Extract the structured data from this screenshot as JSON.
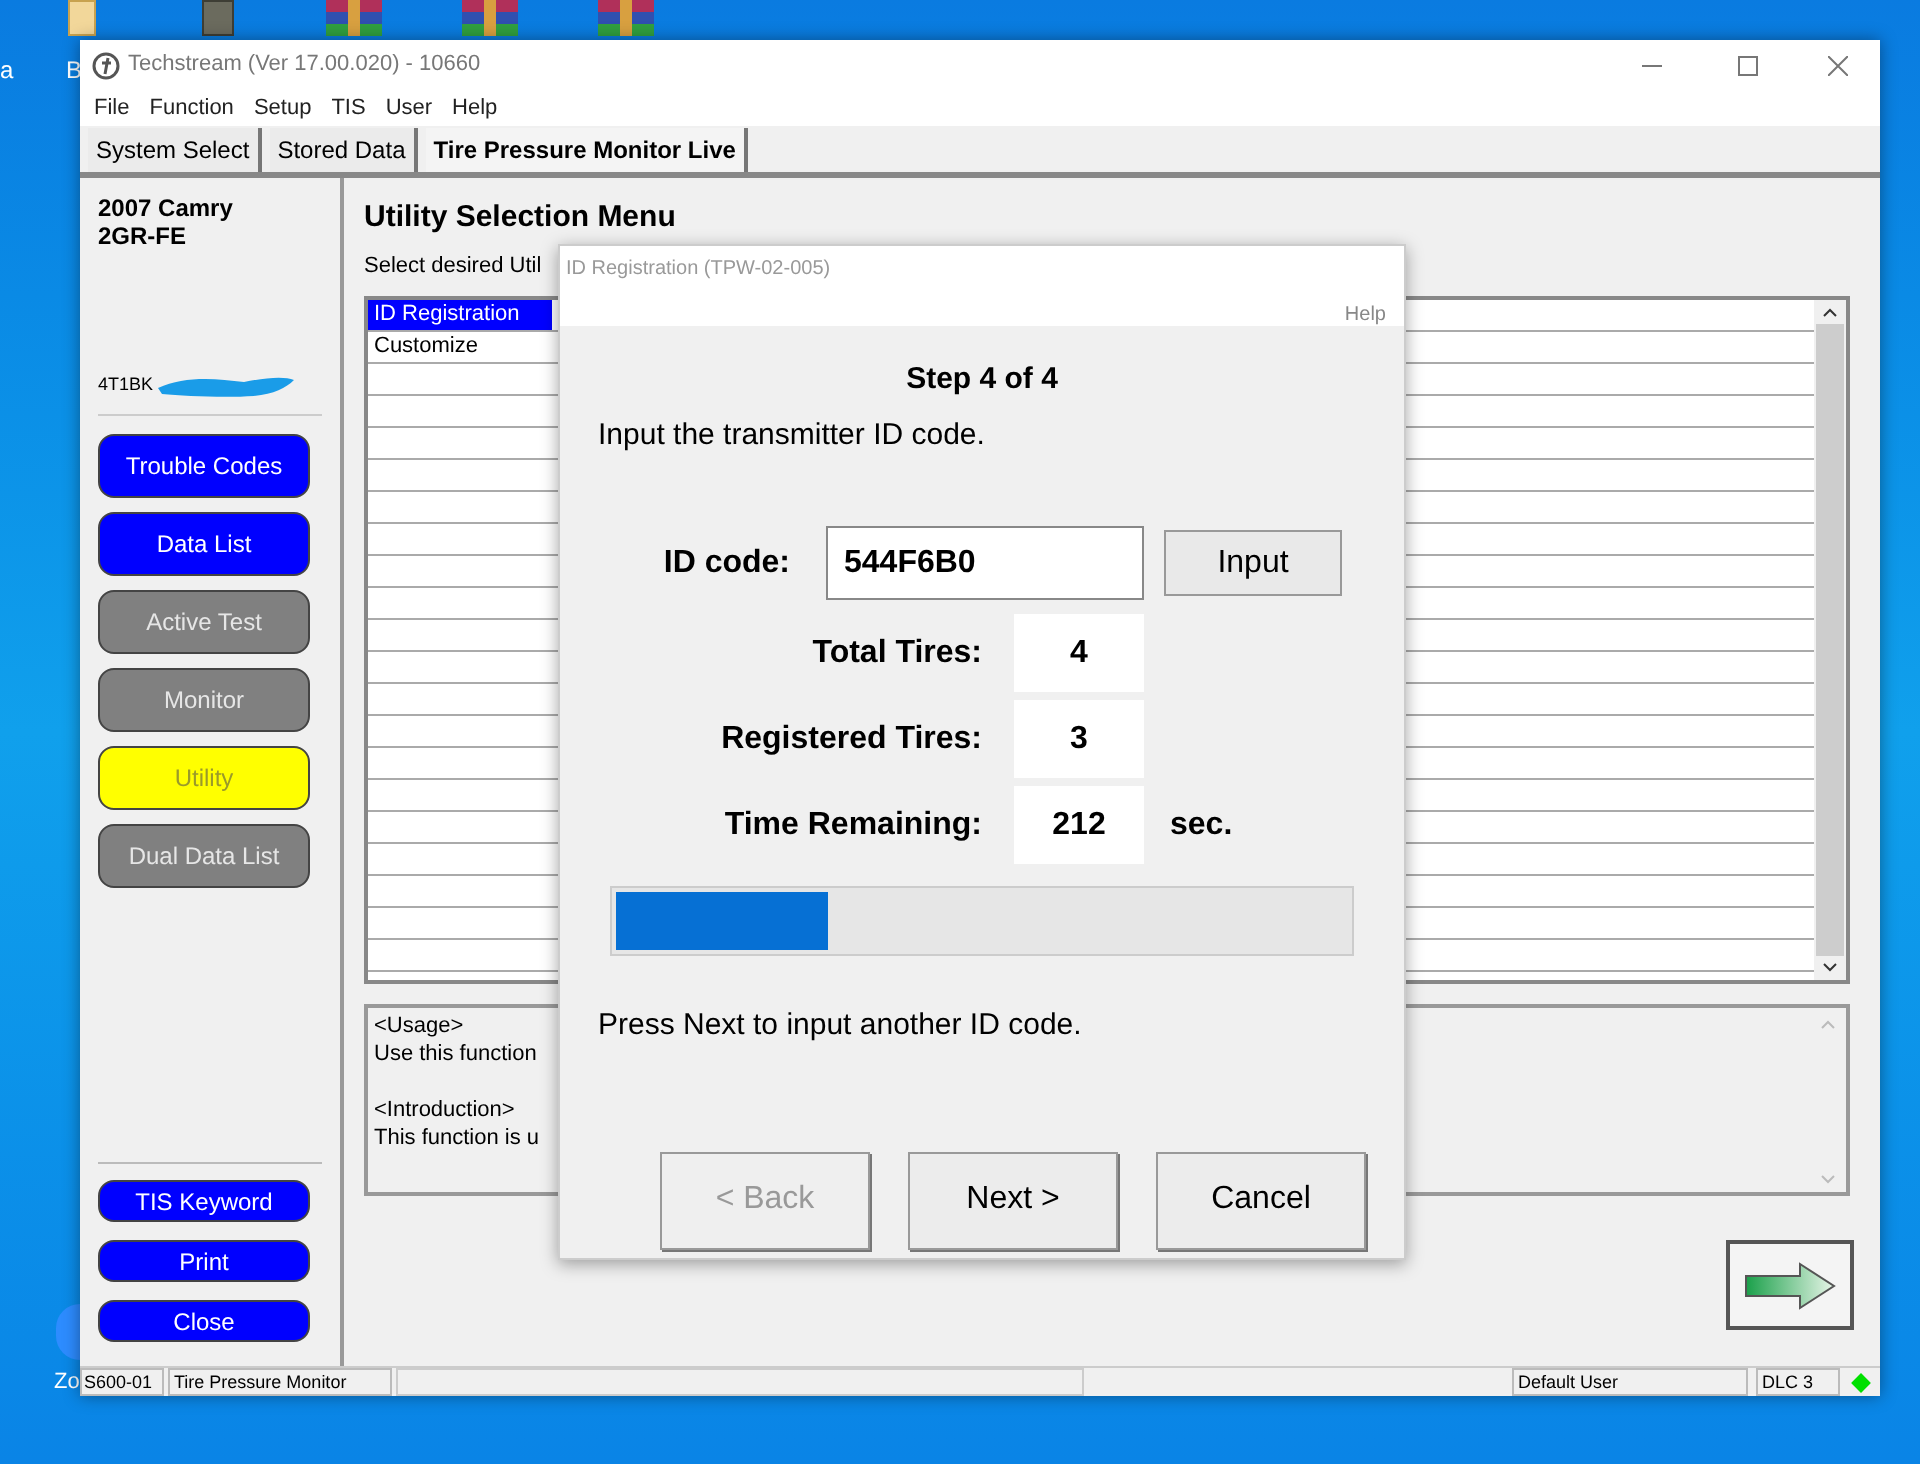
{
  "desktop": {
    "icon_labels": [
      "a",
      "B",
      "Zo"
    ]
  },
  "window": {
    "title": "Techstream (Ver 17.00.020) - 10660",
    "menu": [
      "File",
      "Function",
      "Setup",
      "TIS",
      "User",
      "Help"
    ],
    "tabs": [
      {
        "label": "System Select",
        "selected": false
      },
      {
        "label": "Stored Data",
        "selected": false
      },
      {
        "label": "Tire Pressure Monitor Live",
        "selected": true
      }
    ],
    "vehicle": {
      "model": "2007 Camry",
      "engine": "2GR-FE",
      "vin": "4T1BK"
    },
    "sidebar_buttons": [
      {
        "label": "Trouble Codes",
        "selected": false,
        "disabled": false
      },
      {
        "label": "Data List",
        "selected": false,
        "disabled": false
      },
      {
        "label": "Active Test",
        "selected": false,
        "disabled": true
      },
      {
        "label": "Monitor",
        "selected": false,
        "disabled": true
      },
      {
        "label": "Utility",
        "selected": true,
        "disabled": true
      },
      {
        "label": "Dual Data List",
        "selected": false,
        "disabled": true
      }
    ],
    "sidebar_bottom_buttons": [
      "TIS Keyword",
      "Print",
      "Close"
    ],
    "main": {
      "heading": "Utility Selection Menu",
      "instruction": "Select desired Util",
      "list": [
        {
          "label": "ID Registration",
          "selected": true
        },
        {
          "label": "Customize",
          "selected": false
        }
      ],
      "description": [
        {
          "heading": "<Usage>",
          "text": "Use this function"
        },
        {
          "heading": "<Introduction>",
          "text": "This function is u"
        }
      ]
    },
    "status_bar": {
      "cells": [
        "S600-01",
        "Tire Pressure Monitor"
      ],
      "user": "Default User",
      "port": "DLC 3",
      "connected": true
    }
  },
  "dialog": {
    "title": "ID Registration (TPW-02-005)",
    "help": "Help",
    "step": "Step 4 of 4",
    "prompt": "Input the transmitter ID code.",
    "id_code": {
      "label": "ID code:",
      "value": "544F6B0",
      "button": "Input"
    },
    "fields": [
      {
        "label": "Total Tires:",
        "value": "4"
      },
      {
        "label": "Registered Tires:",
        "value": "3"
      },
      {
        "label": "Time Remaining:",
        "value": "212",
        "unit": "sec."
      }
    ],
    "progress": {
      "level": 0.29
    },
    "note": "Press Next to input another ID code.",
    "buttons": [
      {
        "label": "< Back",
        "disabled": true
      },
      {
        "label": "Next >",
        "disabled": false
      },
      {
        "label": "Cancel",
        "disabled": false
      }
    ]
  }
}
